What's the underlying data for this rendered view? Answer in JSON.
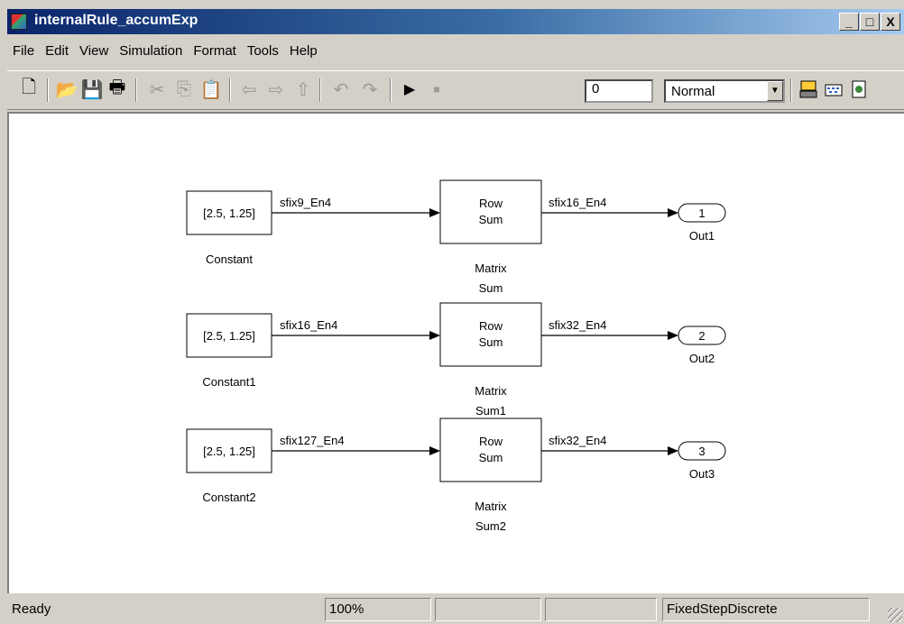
{
  "window": {
    "title": "internalRule_accumExp",
    "controls": {
      "minimize": "_",
      "maximize": "□",
      "close": "X"
    }
  },
  "menu": [
    "File",
    "Edit",
    "View",
    "Simulation",
    "Format",
    "Tools",
    "Help"
  ],
  "toolbar": {
    "buttons": [
      "new-file",
      "open",
      "save",
      "print",
      "cut",
      "copy",
      "paste",
      "back",
      "forward",
      "up",
      "undo",
      "redo",
      "start-simulation",
      "stop-simulation",
      "build",
      "library-browser",
      "model-explorer"
    ],
    "stop_time": "0",
    "sim_mode": "Normal"
  },
  "diagram": {
    "rows": [
      {
        "constant_value": "[2.5, 1.25]",
        "constant_name": "Constant",
        "in_signal": "sfix9_En4",
        "sum_line1": "Row",
        "sum_line2": "Sum",
        "sum_name_line1": "Matrix",
        "sum_name_line2": "Sum",
        "out_signal": "sfix16_En4",
        "out_port": "1",
        "out_name": "Out1"
      },
      {
        "constant_value": "[2.5, 1.25]",
        "constant_name": "Constant1",
        "in_signal": "sfix16_En4",
        "sum_line1": "Row",
        "sum_line2": "Sum",
        "sum_name_line1": "Matrix",
        "sum_name_line2": "Sum1",
        "out_signal": "sfix32_En4",
        "out_port": "2",
        "out_name": "Out2"
      },
      {
        "constant_value": "[2.5, 1.25]",
        "constant_name": "Constant2",
        "in_signal": "sfix127_En4",
        "sum_line1": "Row",
        "sum_line2": "Sum",
        "sum_name_line1": "Matrix",
        "sum_name_line2": "Sum2",
        "out_signal": "sfix32_En4",
        "out_port": "3",
        "out_name": "Out3"
      }
    ]
  },
  "status": {
    "state": "Ready",
    "zoom": "100%",
    "solver": "FixedStepDiscrete"
  }
}
